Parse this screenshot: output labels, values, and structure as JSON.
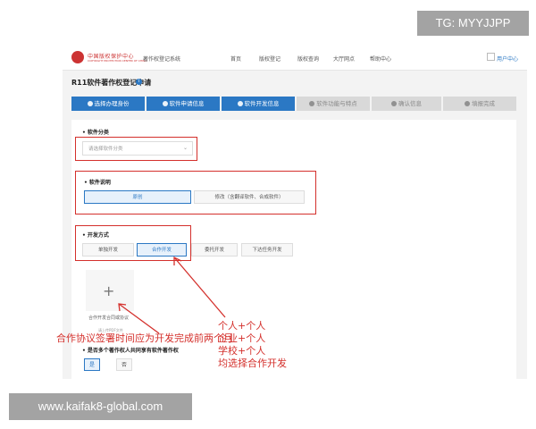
{
  "watermark_top": "TG: MYYJJPP",
  "watermark_bottom": "www.kaifak8-global.com",
  "header": {
    "logo_text": "中国版权保护中心",
    "logo_sub": "COPYRIGHT PROTECTION CENTER OF CHINA",
    "system_name": "著作权登记系统",
    "nav": [
      "首页",
      "版权登记",
      "版权查询",
      "大厅网点",
      "帮助中心"
    ],
    "user": "用户中心"
  },
  "page_title": "R11软件著作权登记申请",
  "steps": [
    {
      "label": "选择办理身份",
      "active": true
    },
    {
      "label": "软件申请信息",
      "active": true
    },
    {
      "label": "软件开发信息",
      "active": true
    },
    {
      "label": "软件功能与特点",
      "active": false
    },
    {
      "label": "确认信息",
      "active": false
    },
    {
      "label": "填报完成",
      "active": false
    }
  ],
  "form": {
    "category_label": "• 软件分类",
    "category_placeholder": "请选择软件分类",
    "desc_label": "• 软件说明",
    "desc_options": [
      "原创",
      "修改（含翻译软件、合成软件）"
    ],
    "dev_label": "• 开发方式",
    "dev_options": [
      "单独开发",
      "合作开发",
      "委托开发",
      "下达任务开发"
    ],
    "upload_caption": "合作开发合同或协议",
    "upload_sub": "请上传PDF文件",
    "multi_owner_label": "• 是否多个著作权人共同享有软件著作权",
    "yes": "是",
    "no": "否"
  },
  "annotations": {
    "left": "合作协议签署时间应为开发完成前两个月",
    "right": [
      "个人+个人",
      "企业+个人",
      "学校+个人",
      "均选择合作开发"
    ]
  },
  "colors": {
    "primary": "#2b78c4",
    "annotation": "#d4302c",
    "watermark": "#a3a3a3"
  }
}
